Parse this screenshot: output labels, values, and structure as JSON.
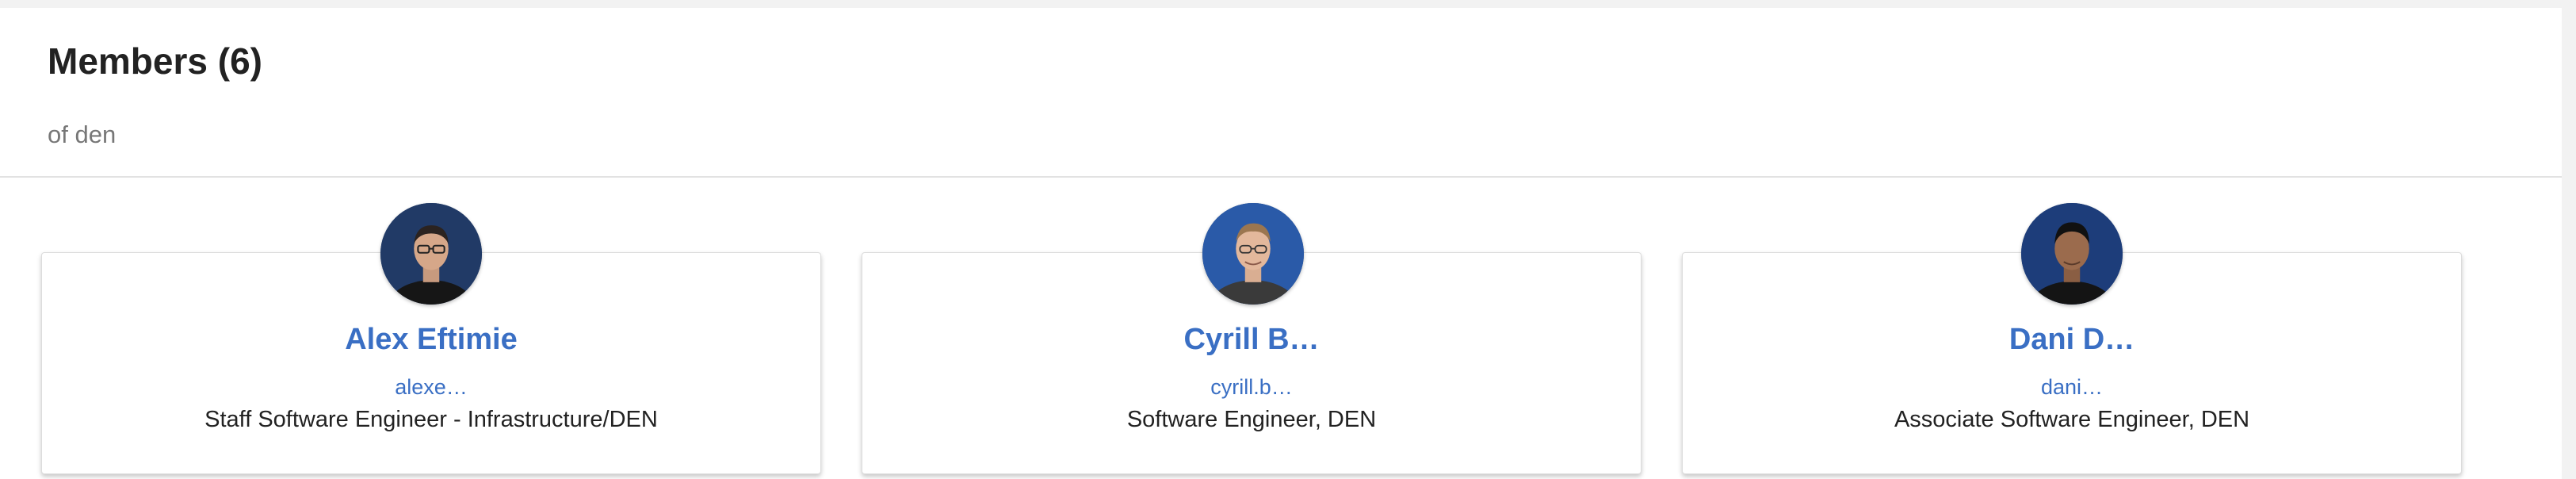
{
  "header": {
    "title": "Members (6)",
    "subtitle": "of den"
  },
  "members": [
    {
      "name": "Alex Eftimie",
      "email": "alexe…",
      "role": "Staff Software Engineer - Infrastructure/DEN"
    },
    {
      "name": "Cyrill B…",
      "email": "cyrill.b…",
      "role": "Software Engineer, DEN"
    },
    {
      "name": "Dani D…",
      "email": "dani…",
      "role": "Associate Software Engineer, DEN"
    }
  ],
  "colors": {
    "accent": "#3a6fc4",
    "title": "#222222",
    "muted": "#777777",
    "avatar_bg": "#1f3a6e"
  }
}
